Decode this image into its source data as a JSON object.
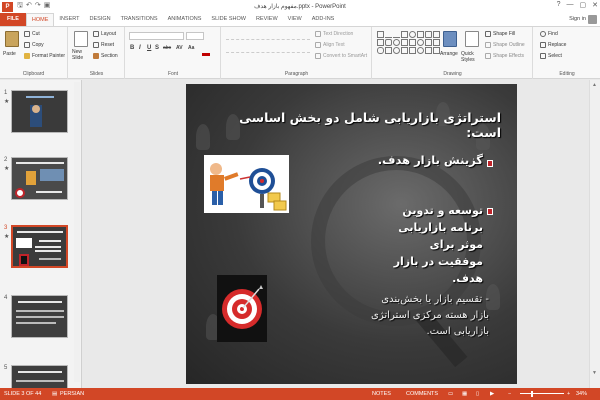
{
  "titlebar": {
    "app_letter": "P",
    "title": "مفهوم بازار هدف.pptx - PowerPoint",
    "help": "?",
    "minimize": "—",
    "restore": "▢",
    "close": "✕"
  },
  "tabs": [
    {
      "label": "FILE"
    },
    {
      "label": "HOME"
    },
    {
      "label": "INSERT"
    },
    {
      "label": "DESIGN"
    },
    {
      "label": "TRANSITIONS"
    },
    {
      "label": "ANIMATIONS"
    },
    {
      "label": "SLIDE SHOW"
    },
    {
      "label": "REVIEW"
    },
    {
      "label": "VIEW"
    },
    {
      "label": "ADD-INS"
    }
  ],
  "signin": "Sign in",
  "ribbon": {
    "clipboard": {
      "paste": "Paste",
      "cut": "Cut",
      "copy": "Copy",
      "format_painter": "Format Painter",
      "label": "Clipboard"
    },
    "slides": {
      "new_slide": "New",
      "new_slide_2": "Slide",
      "layout": "Layout",
      "reset": "Reset",
      "section": "Section",
      "label": "Slides"
    },
    "font": {
      "bold": "B",
      "italic": "I",
      "underline": "U",
      "shadow": "S",
      "strike": "abc",
      "spacing": "AV",
      "case": "Aa",
      "label": "Font"
    },
    "paragraph": {
      "text_direction": "Text Direction",
      "align_text": "Align Text",
      "convert_smartart": "Convert to SmartArt",
      "label": "Paragraph"
    },
    "drawing": {
      "arrange": "Arrange",
      "quick_styles": "Quick Styles",
      "shape_fill": "Shape Fill",
      "shape_outline": "Shape Outline",
      "shape_effects": "Shape Effects",
      "label": "Drawing"
    },
    "editing": {
      "find": "Find",
      "replace": "Replace",
      "select": "Select",
      "label": "Editing"
    }
  },
  "thumbnails": [
    {
      "number": "1",
      "star": "★"
    },
    {
      "number": "2",
      "star": "★"
    },
    {
      "number": "3",
      "star": "★"
    },
    {
      "number": "4",
      "star": ""
    },
    {
      "number": "5",
      "star": ""
    }
  ],
  "slide": {
    "title": "استراتژی بازاریابی شامل دو بخش اساسی است:",
    "bullet1": "گزینش بازار هدف.",
    "bullet2": "توسعه و تدوین برنامه بازاریابی موثر برای موفقیت در بازار هدف.",
    "note": "- تقسیم بازار یا بخش‌بندی بازار هسته مرکزی استراتژی بازاریابی است."
  },
  "statusbar": {
    "slide_info": "SLIDE 3 OF 44",
    "language": "PERSIAN",
    "notes": "NOTES",
    "comments": "COMMENTS",
    "zoom": "34%"
  },
  "colors": {
    "accent": "#d24726",
    "bullet": "#c0242a"
  }
}
